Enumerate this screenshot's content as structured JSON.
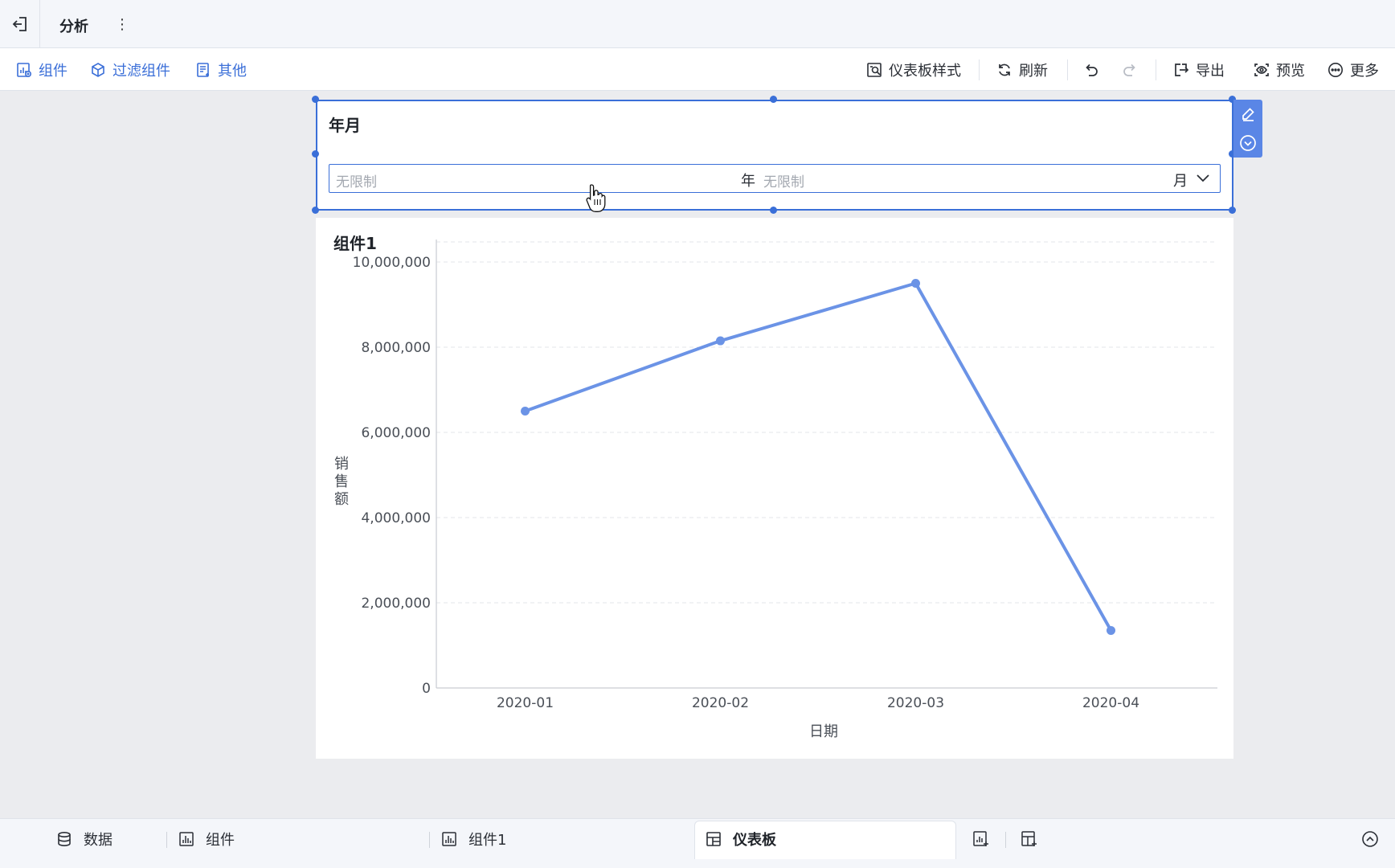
{
  "app": {
    "title": "分析"
  },
  "toolbar": {
    "left": [
      {
        "label": "组件",
        "icon": "chart-widget-icon"
      },
      {
        "label": "过滤组件",
        "icon": "filter-widget-icon"
      },
      {
        "label": "其他",
        "icon": "other-widget-icon"
      }
    ],
    "right": {
      "style_label": "仪表板样式",
      "refresh_label": "刷新",
      "export_label": "导出",
      "preview_label": "预览",
      "more_label": "更多"
    }
  },
  "filter": {
    "title": "年月",
    "start_placeholder": "无限制",
    "start_unit": "年",
    "end_placeholder": "无限制",
    "end_unit": "月"
  },
  "chart_widget": {
    "title": "组件1"
  },
  "chart_data": {
    "type": "line",
    "title": "组件1",
    "xlabel": "日期",
    "ylabel": "销售额",
    "categories": [
      "2020-01",
      "2020-02",
      "2020-03",
      "2020-04"
    ],
    "values": [
      6500000,
      8150000,
      9500000,
      1350000
    ],
    "yticks": [
      "10,000,000",
      "8,000,000",
      "6,000,000",
      "4,000,000",
      "2,000,000",
      "0"
    ],
    "ytick_values": [
      10000000,
      8000000,
      6000000,
      4000000,
      2000000,
      0
    ],
    "ylim": [
      0,
      10000000
    ],
    "grid": true,
    "color": "#6b93e6"
  },
  "bottom_tabs": [
    {
      "label": "数据",
      "icon": "database-icon"
    },
    {
      "label": "组件",
      "icon": "bar-chart-icon"
    },
    {
      "label": "组件1",
      "icon": "bar-chart-icon"
    },
    {
      "label": "仪表板",
      "icon": "dashboard-icon",
      "active": true
    }
  ],
  "colors": {
    "accent": "#3a6fd8",
    "line": "#6b93e6"
  }
}
